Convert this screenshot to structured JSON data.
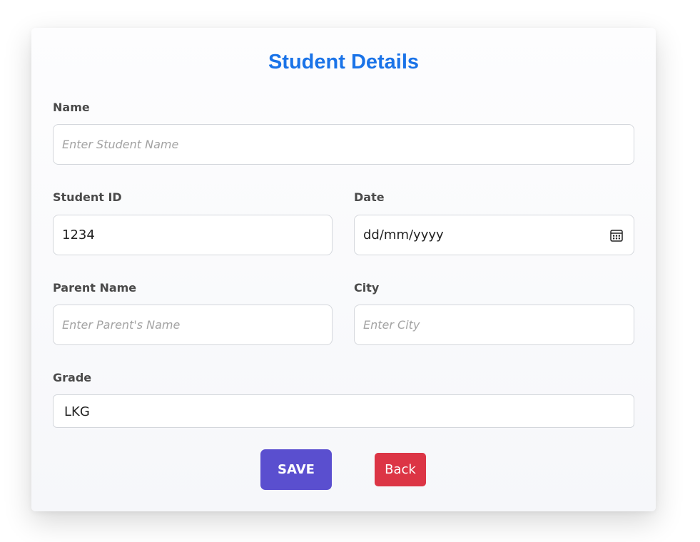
{
  "form": {
    "title": "Student Details",
    "name": {
      "label": "Name",
      "placeholder": "Enter Student Name",
      "value": ""
    },
    "student_id": {
      "label": "Student ID",
      "value": "1234"
    },
    "date": {
      "label": "Date",
      "value": "dd/mm/yyyy",
      "icon": "calendar-icon"
    },
    "parent_name": {
      "label": "Parent Name",
      "placeholder": "Enter Parent's Name",
      "value": ""
    },
    "city": {
      "label": "City",
      "placeholder": "Enter City",
      "value": ""
    },
    "grade": {
      "label": "Grade",
      "selected": "LKG"
    },
    "buttons": {
      "save_label": "SAVE",
      "back_label": "Back"
    }
  },
  "colors": {
    "title": "#1a73e8",
    "save_button": "#5a4fcf",
    "back_button": "#dc3545",
    "label": "#4a4a4a"
  }
}
